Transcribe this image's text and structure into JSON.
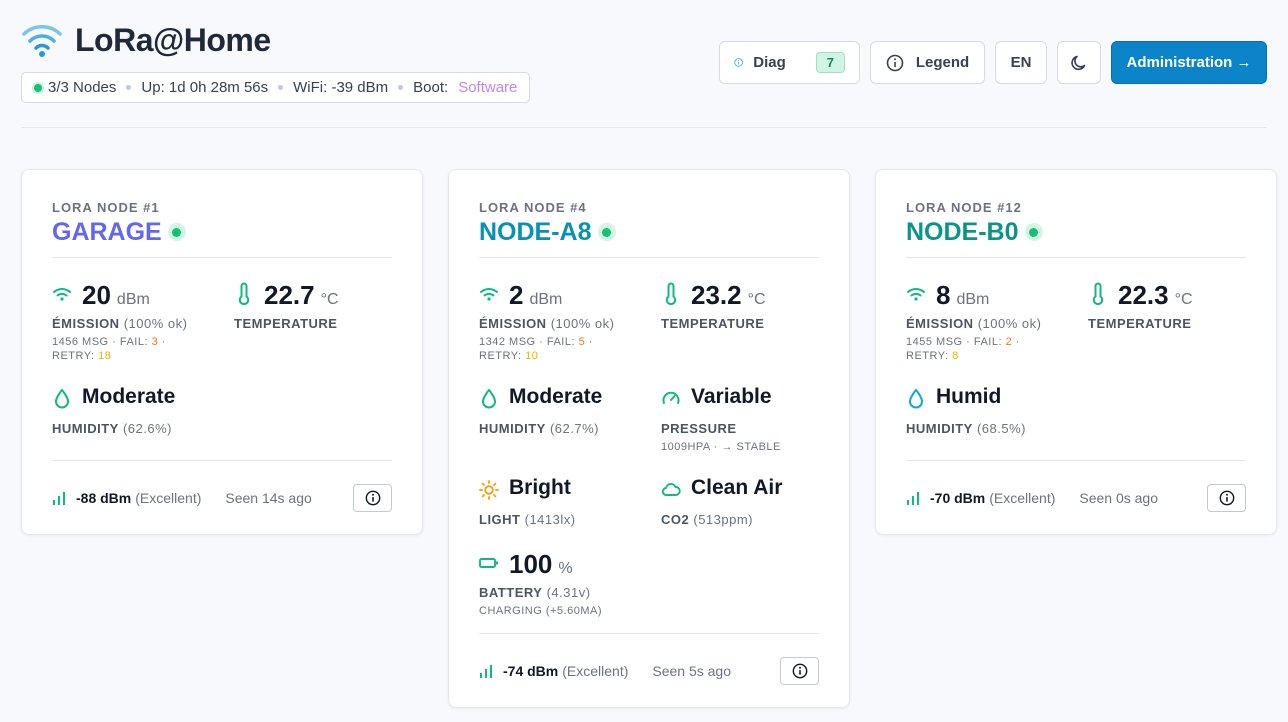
{
  "header": {
    "title": "LoRa@Home",
    "status": {
      "nodes": "3/3 Nodes",
      "uptime": "Up: 1d 0h 28m 56s",
      "wifi": "WiFi: -39 dBm",
      "boot_label": "Boot:",
      "boot_value": "Software"
    },
    "actions": {
      "diag_label": "Diag",
      "diag_count": "7",
      "legend_label": "Legend",
      "lang_label": "EN",
      "admin_label": "Administration →"
    }
  },
  "nodes": [
    {
      "label": "LORA NODE #1",
      "name": "GARAGE",
      "color": "#6366f1",
      "emission": {
        "value": "20",
        "unit": "dBm",
        "label": "ÉMISSION",
        "pct": "(100% ok)",
        "msg": "1456 MSG · FAIL: ",
        "fail": "3",
        "retry_label": "RETRY: ",
        "retry": "18"
      },
      "temperature": {
        "value": "22.7",
        "unit": "°C",
        "label": "TEMPERATURE"
      },
      "humidity": {
        "word": "Moderate",
        "label": "HUMIDITY",
        "pct": "(62.6%)"
      },
      "footer": {
        "rssi": "-88 dBm",
        "quality": "(Excellent)",
        "seen": "Seen 14s ago"
      }
    },
    {
      "label": "LORA NODE #4",
      "name": "NODE-A8",
      "color": "#0891b2",
      "emission": {
        "value": "2",
        "unit": "dBm",
        "label": "ÉMISSION",
        "pct": "(100% ok)",
        "msg": "1342 MSG · FAIL: ",
        "fail": "5",
        "retry_label": "RETRY: ",
        "retry": "10"
      },
      "temperature": {
        "value": "23.2",
        "unit": "°C",
        "label": "TEMPERATURE"
      },
      "humidity": {
        "word": "Moderate",
        "label": "HUMIDITY",
        "pct": "(62.7%)"
      },
      "pressure": {
        "word": "Variable",
        "label": "PRESSURE",
        "sub": "1009HPA · → STABLE"
      },
      "light": {
        "word": "Bright",
        "label": "LIGHT",
        "pct": "(1413lx)"
      },
      "co2": {
        "word": "Clean Air",
        "label": "CO2",
        "pct": "(513ppm)"
      },
      "battery": {
        "value": "100",
        "unit": "%",
        "label": "BATTERY",
        "pct": "(4.31v)",
        "sub": "CHARGING (+5.60MA)"
      },
      "footer": {
        "rssi": "-74 dBm",
        "quality": "(Excellent)",
        "seen": "Seen 5s ago"
      }
    },
    {
      "label": "LORA NODE #12",
      "name": "NODE-B0",
      "color": "#0d9488",
      "emission": {
        "value": "8",
        "unit": "dBm",
        "label": "ÉMISSION",
        "pct": "(100% ok)",
        "msg": "1455 MSG · FAIL: ",
        "fail": "2",
        "retry_label": "RETRY: ",
        "retry": "8"
      },
      "temperature": {
        "value": "22.3",
        "unit": "°C",
        "label": "TEMPERATURE"
      },
      "humidity": {
        "word": "Humid",
        "label": "HUMIDITY",
        "pct": "(68.5%)"
      },
      "footer": {
        "rssi": "-70 dBm",
        "quality": "(Excellent)",
        "seen": "Seen 0s ago"
      }
    }
  ],
  "colors": {
    "accent_green": "#16c172",
    "admin_blue": "#0b84c9",
    "boot_purple": "#c084fc"
  }
}
